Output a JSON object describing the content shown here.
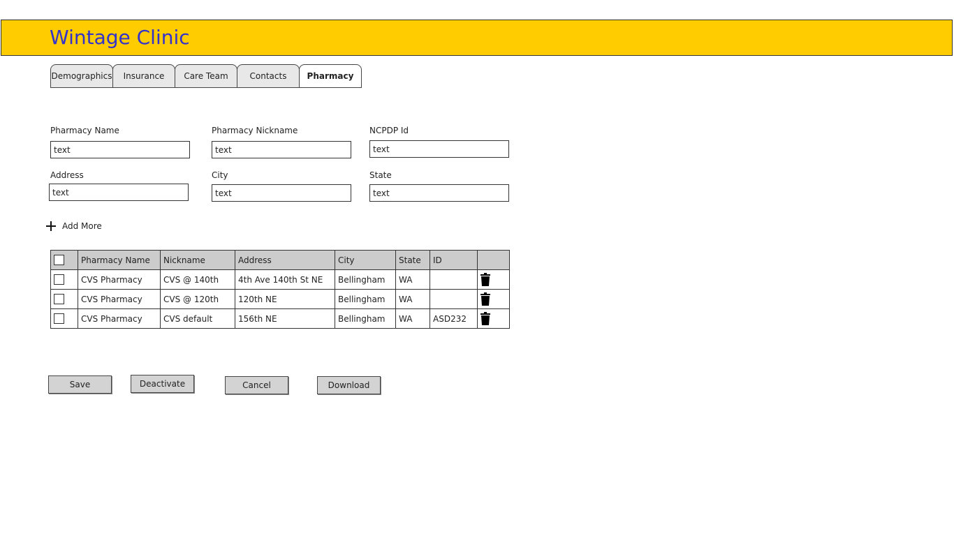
{
  "app": {
    "title": "Wintage Clinic",
    "header_color": "#ffcc00",
    "title_color": "#3333cc"
  },
  "tabs": [
    {
      "label": "Demographics",
      "active": false
    },
    {
      "label": "Insurance",
      "active": false
    },
    {
      "label": "Care Team",
      "active": false
    },
    {
      "label": "Contacts",
      "active": false
    },
    {
      "label": "Pharmacy",
      "active": true
    }
  ],
  "form": {
    "pharmacy_name": {
      "label": "Pharmacy Name",
      "value": "text"
    },
    "pharmacy_nickname": {
      "label": "Pharmacy Nickname",
      "value": "text"
    },
    "ncpdp_id": {
      "label": "NCPDP Id",
      "value": "text"
    },
    "address": {
      "label": "Address",
      "value": "text"
    },
    "city": {
      "label": "City",
      "value": "text"
    },
    "state": {
      "label": "State",
      "value": "text"
    }
  },
  "add_more": {
    "label": "Add More",
    "icon": "plus-icon"
  },
  "table": {
    "columns": [
      "Pharmacy Name",
      "Nickname",
      "Address",
      "City",
      "State",
      "ID"
    ],
    "rows": [
      {
        "name": "CVS Pharmacy",
        "nickname": "CVS @ 140th",
        "address": "4th Ave 140th St NE",
        "city": "Bellingham",
        "state": "WA",
        "id": ""
      },
      {
        "name": "CVS Pharmacy",
        "nickname": "CVS @ 120th",
        "address": "120th NE",
        "city": "Bellingham",
        "state": "WA",
        "id": ""
      },
      {
        "name": "CVS Pharmacy",
        "nickname": "CVS default",
        "address": "156th NE",
        "city": "Bellingham",
        "state": "WA",
        "id": "ASD232"
      }
    ],
    "row_action_icon": "trash-icon"
  },
  "actions": {
    "save": "Save",
    "deactivate": "Deactivate",
    "cancel": "Cancel",
    "download": "Download"
  }
}
